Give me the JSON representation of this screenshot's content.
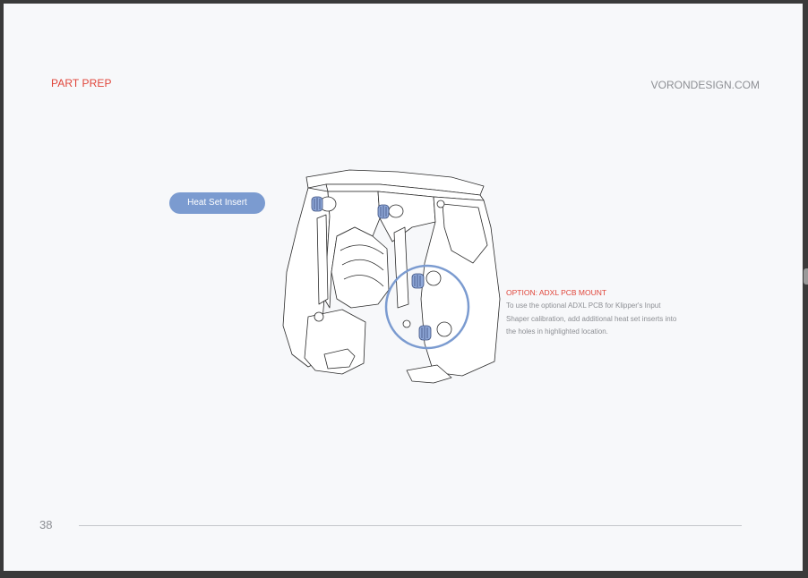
{
  "header": {
    "section_title": "PART PREP",
    "site_url": "VORONDESIGN.COM"
  },
  "figure": {
    "callout_label": "Heat Set Insert",
    "highlight_color": "#7b9bd0",
    "line_color": "#2b2b2b"
  },
  "option": {
    "title": "OPTION: ADXL PCB MOUNT",
    "lines": [
      "To use the optional ADXL PCB for Klipper's Input",
      "Shaper calibration, add additional heat set inserts into",
      "the holes in highlighted location."
    ]
  },
  "footer": {
    "page_number": "38"
  },
  "colors": {
    "accent_red": "#e0453a",
    "muted_text": "#8d8f94",
    "page_bg": "#f7f8fa"
  }
}
